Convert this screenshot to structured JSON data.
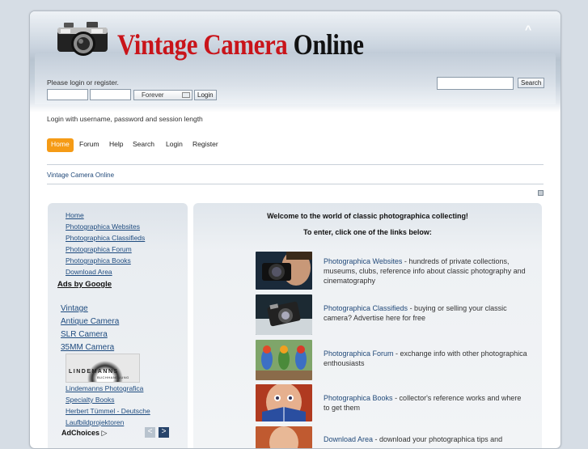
{
  "header": {
    "title_part1": "Vintage Camera",
    "title_part2": "Online",
    "collapse_glyph": "^"
  },
  "login": {
    "message": "Please login or register.",
    "duration_selected": "Forever",
    "login_button": "Login",
    "hint": "Login with username, password and session length"
  },
  "search": {
    "button": "Search"
  },
  "nav": {
    "items": [
      "Home",
      "Forum",
      "Help",
      "Search",
      "Login",
      "Register"
    ]
  },
  "breadcrumb": "Vintage Camera Online",
  "sidebar": {
    "links": [
      "Home",
      "Photographica Websites",
      "Photographica Classifieds",
      "Photographica Forum",
      "Photographica Books",
      "Download Area"
    ],
    "ads_title": "Ads by Google",
    "ad_links": [
      "Vintage",
      "Antique Camera",
      "SLR Camera",
      "35MM Camera"
    ],
    "sponsor_logo_text": "LINDEMANNS",
    "sponsor_logo_sub": "BUCHHANDLUNG",
    "sponsor_links": [
      "Lindemanns Photografica",
      "Specialty Books",
      "Herbert Tümmel - Deutsche",
      "Laufbildprojektoren"
    ],
    "adchoices": "AdChoices",
    "ad_prev": "<",
    "ad_next": ">"
  },
  "main": {
    "welcome": "Welcome to the world of classic photographica collecting!",
    "enter": "To enter, click one of the links below:",
    "entries": [
      {
        "link": "Photographica Websites",
        "desc": " - hundreds of private collections, museums, clubs, reference info about classic photography and cinematography"
      },
      {
        "link": "Photographica Classifieds",
        "desc": " - buying or selling your classic camera? Advertise here for free"
      },
      {
        "link": "Photographica Forum",
        "desc": " - exchange info with other photographica enthousiasts"
      },
      {
        "link": "Photographica Books",
        "desc": " - collector's reference works and where to get them"
      },
      {
        "link": "Download Area",
        "desc": " - download your photographica tips and"
      }
    ]
  },
  "colors": {
    "title_red": "#c9141a",
    "nav_active": "#f59b16",
    "link_blue": "#224a7a"
  }
}
